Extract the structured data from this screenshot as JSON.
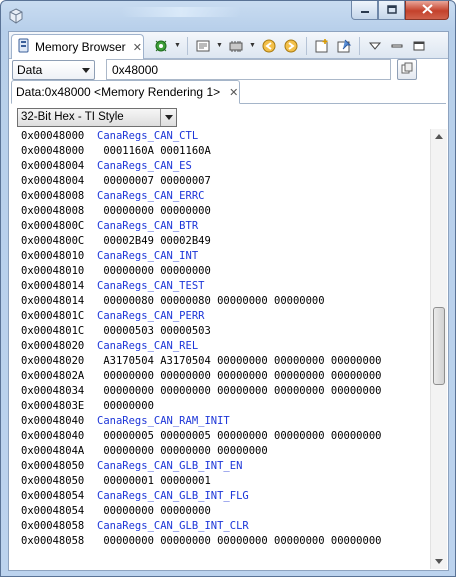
{
  "window": {
    "caption_buttons": [
      "minimize-icon",
      "maximize-icon",
      "close-icon"
    ]
  },
  "view": {
    "tab_label": "Memory Browser",
    "tab_icon": "memory-icon",
    "toolbar_icons": [
      "refresh-chip-icon",
      "new-tab-icon",
      "import-export-icon",
      "back-icon",
      "forward-icon",
      "new-view-icon",
      "pin-icon",
      "view-menu-icon",
      "minimize-view-icon",
      "maximize-view-icon"
    ]
  },
  "address": {
    "memory_space": "Data",
    "value": "0x48000"
  },
  "rendering": {
    "tab_label": "Data:0x48000 <Memory Rendering 1>",
    "format": "32-Bit Hex - TI Style"
  },
  "memory_rows": [
    {
      "addr": "0x00048000",
      "text": "CanaRegs_CAN_CTL",
      "symbol": true
    },
    {
      "addr": "0x00048000",
      "text": "0001160A 0001160A",
      "symbol": false
    },
    {
      "addr": "0x00048004",
      "text": "CanaRegs_CAN_ES",
      "symbol": true
    },
    {
      "addr": "0x00048004",
      "text": "00000007 00000007",
      "symbol": false
    },
    {
      "addr": "0x00048008",
      "text": "CanaRegs_CAN_ERRC",
      "symbol": true
    },
    {
      "addr": "0x00048008",
      "text": "00000000 00000000",
      "symbol": false
    },
    {
      "addr": "0x0004800C",
      "text": "CanaRegs_CAN_BTR",
      "symbol": true
    },
    {
      "addr": "0x0004800C",
      "text": "00002B49 00002B49",
      "symbol": false
    },
    {
      "addr": "0x00048010",
      "text": "CanaRegs_CAN_INT",
      "symbol": true
    },
    {
      "addr": "0x00048010",
      "text": "00000000 00000000",
      "symbol": false
    },
    {
      "addr": "0x00048014",
      "text": "CanaRegs_CAN_TEST",
      "symbol": true
    },
    {
      "addr": "0x00048014",
      "text": "00000080 00000080 00000000 00000000",
      "symbol": false
    },
    {
      "addr": "0x0004801C",
      "text": "CanaRegs_CAN_PERR",
      "symbol": true
    },
    {
      "addr": "0x0004801C",
      "text": "00000503 00000503",
      "symbol": false
    },
    {
      "addr": "0x00048020",
      "text": "CanaRegs_CAN_REL",
      "symbol": true
    },
    {
      "addr": "0x00048020",
      "text": "A3170504 A3170504 00000000 00000000 00000000",
      "symbol": false
    },
    {
      "addr": "0x0004802A",
      "text": "00000000 00000000 00000000 00000000 00000000",
      "symbol": false
    },
    {
      "addr": "0x00048034",
      "text": "00000000 00000000 00000000 00000000 00000000",
      "symbol": false
    },
    {
      "addr": "0x0004803E",
      "text": "00000000",
      "symbol": false
    },
    {
      "addr": "0x00048040",
      "text": "CanaRegs_CAN_RAM_INIT",
      "symbol": true
    },
    {
      "addr": "0x00048040",
      "text": "00000005 00000005 00000000 00000000 00000000",
      "symbol": false
    },
    {
      "addr": "0x0004804A",
      "text": "00000000 00000000 00000000",
      "symbol": false
    },
    {
      "addr": "0x00048050",
      "text": "CanaRegs_CAN_GLB_INT_EN",
      "symbol": true
    },
    {
      "addr": "0x00048050",
      "text": "00000001 00000001",
      "symbol": false
    },
    {
      "addr": "0x00048054",
      "text": "CanaRegs_CAN_GLB_INT_FLG",
      "symbol": true
    },
    {
      "addr": "0x00048054",
      "text": "00000000 00000000",
      "symbol": false
    },
    {
      "addr": "0x00048058",
      "text": "CanaRegs_CAN_GLB_INT_CLR",
      "symbol": true
    },
    {
      "addr": "0x00048058",
      "text": "00000000 00000000 00000000 00000000 00000000",
      "symbol": false
    }
  ],
  "colors": {
    "symbol_text": "#1d36d8",
    "window_frame": "#b7cfea"
  }
}
